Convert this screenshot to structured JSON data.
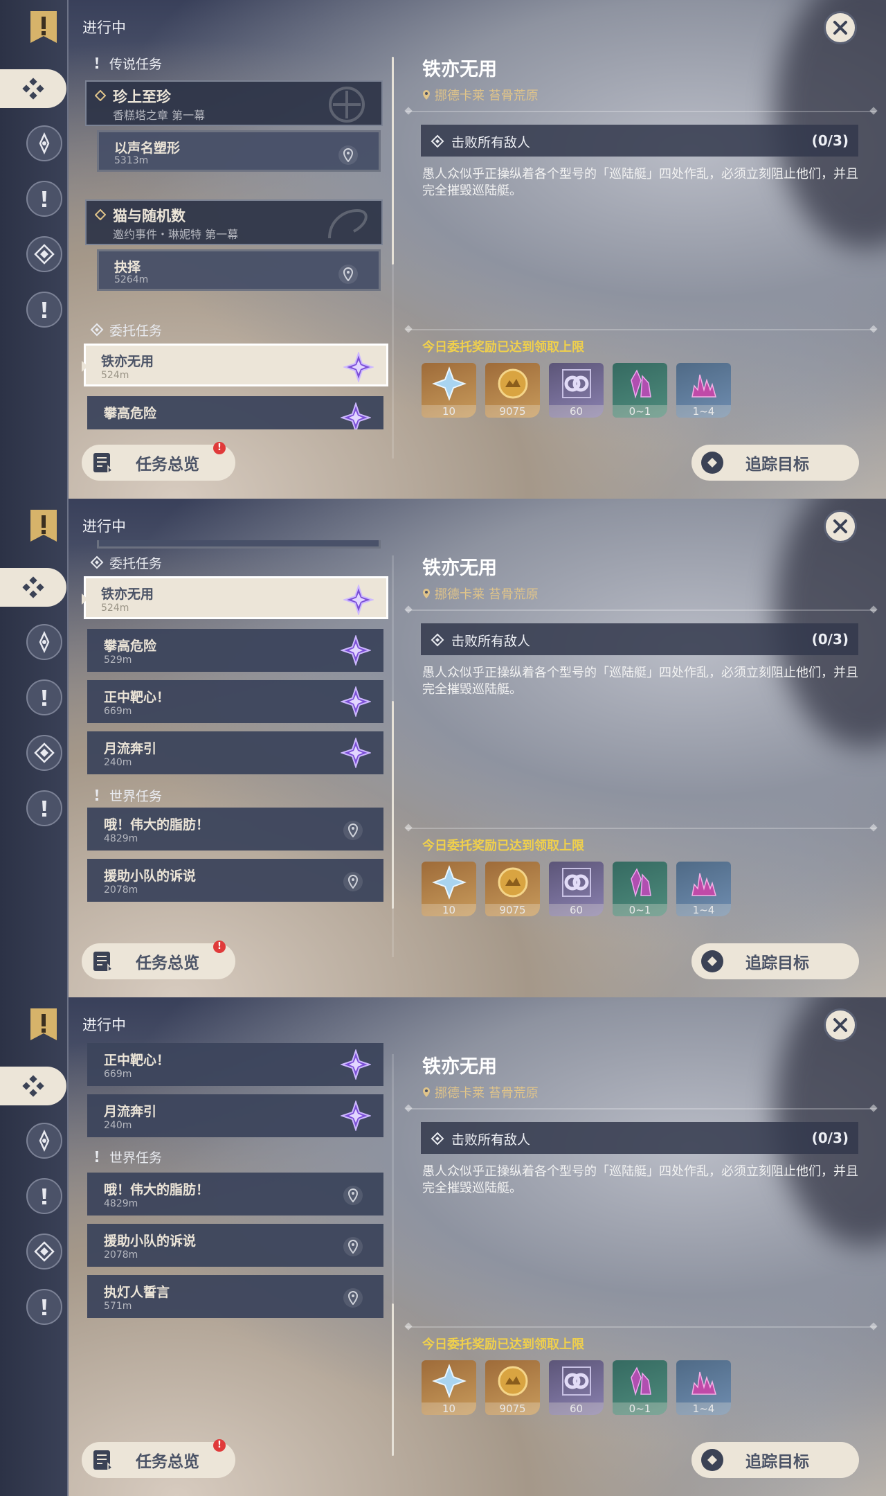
{
  "header": {
    "in_progress": "进行中"
  },
  "sections": {
    "legend": "传说任务",
    "commission": "委托任务",
    "world": "世界任务"
  },
  "legend_quests": [
    {
      "title": "珍上至珍",
      "subtitle": "香糕塔之章 第一幕",
      "step": "以声名塑形",
      "distance": "5313m"
    },
    {
      "title": "猫与随机数",
      "subtitle": "邀约事件・琳妮特 第一幕",
      "step": "抉择",
      "distance": "5264m"
    }
  ],
  "commissions": [
    {
      "title": "铁亦无用",
      "distance": "524m"
    },
    {
      "title": "攀高危险",
      "distance": "529m"
    },
    {
      "title": "正中靶心！",
      "distance": "669m"
    },
    {
      "title": "月流奔引",
      "distance": "240m"
    }
  ],
  "world_quests": [
    {
      "title": "哦！伟大的脂肪！",
      "distance": "4829m"
    },
    {
      "title": "援助小队的诉说",
      "distance": "2078m"
    },
    {
      "title": "执灯人誓言",
      "distance": "571m"
    }
  ],
  "detail": {
    "title": "铁亦无用",
    "location": "挪德卡莱 苔骨荒原",
    "objective": "击败所有敌人",
    "objective_count": "(0/3)",
    "description": "愚人众似乎正操纵着各个型号的「巡陆艇」四处作乱，必须立刻阻止他们，并且完全摧毁巡陆艇。",
    "reward_title": "今日委托奖励已达到领取上限",
    "rewards": [
      {
        "icon": "primogem-icon",
        "count": "10",
        "bg": "gold"
      },
      {
        "icon": "mora-icon",
        "count": "9075",
        "bg": "gold"
      },
      {
        "icon": "friendship-icon",
        "count": "60",
        "bg": "purple"
      },
      {
        "icon": "crystal-icon",
        "count": "0~1",
        "bg": "green"
      },
      {
        "icon": "crystal-cluster-icon",
        "count": "1~4",
        "bg": "blue"
      }
    ]
  },
  "buttons": {
    "overview": "任务总览",
    "overview_badge": "!",
    "track": "追踪目标"
  },
  "colors": {
    "accent_cream": "#ece5d8",
    "reward_gold": "#f0d04c",
    "location_gold": "#e0c48a",
    "badge_red": "#e03a3a"
  }
}
